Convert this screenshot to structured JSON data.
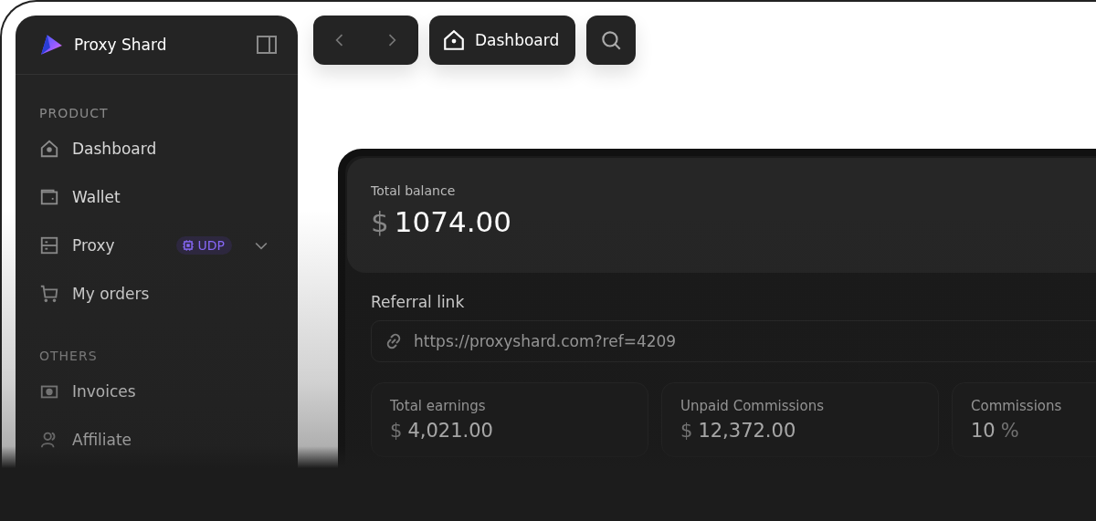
{
  "sidebar": {
    "brand": "Proxy Shard",
    "sections": [
      {
        "title": "PRODUCT",
        "items": [
          {
            "label": "Dashboard"
          },
          {
            "label": "Wallet"
          },
          {
            "label": "Proxy",
            "badge": "UDP",
            "expandable": true
          },
          {
            "label": "My orders"
          }
        ]
      },
      {
        "title": "OTHERS",
        "items": [
          {
            "label": "Invoices"
          },
          {
            "label": "Affiliate"
          }
        ]
      }
    ]
  },
  "topbar": {
    "breadcrumb": "Dashboard"
  },
  "balance": {
    "label": "Total balance",
    "currency": "$",
    "amount": "1074.00"
  },
  "referral": {
    "label": "Referral link",
    "value": "https://proxyshard.com?ref=4209"
  },
  "stats": [
    {
      "label": "Total earnings",
      "prefix": "$",
      "value": "4,021.00"
    },
    {
      "label": "Unpaid Commissions",
      "prefix": "$",
      "value": "12,372.00"
    },
    {
      "label": "Commissions",
      "value": "10",
      "suffix": "%"
    }
  ]
}
